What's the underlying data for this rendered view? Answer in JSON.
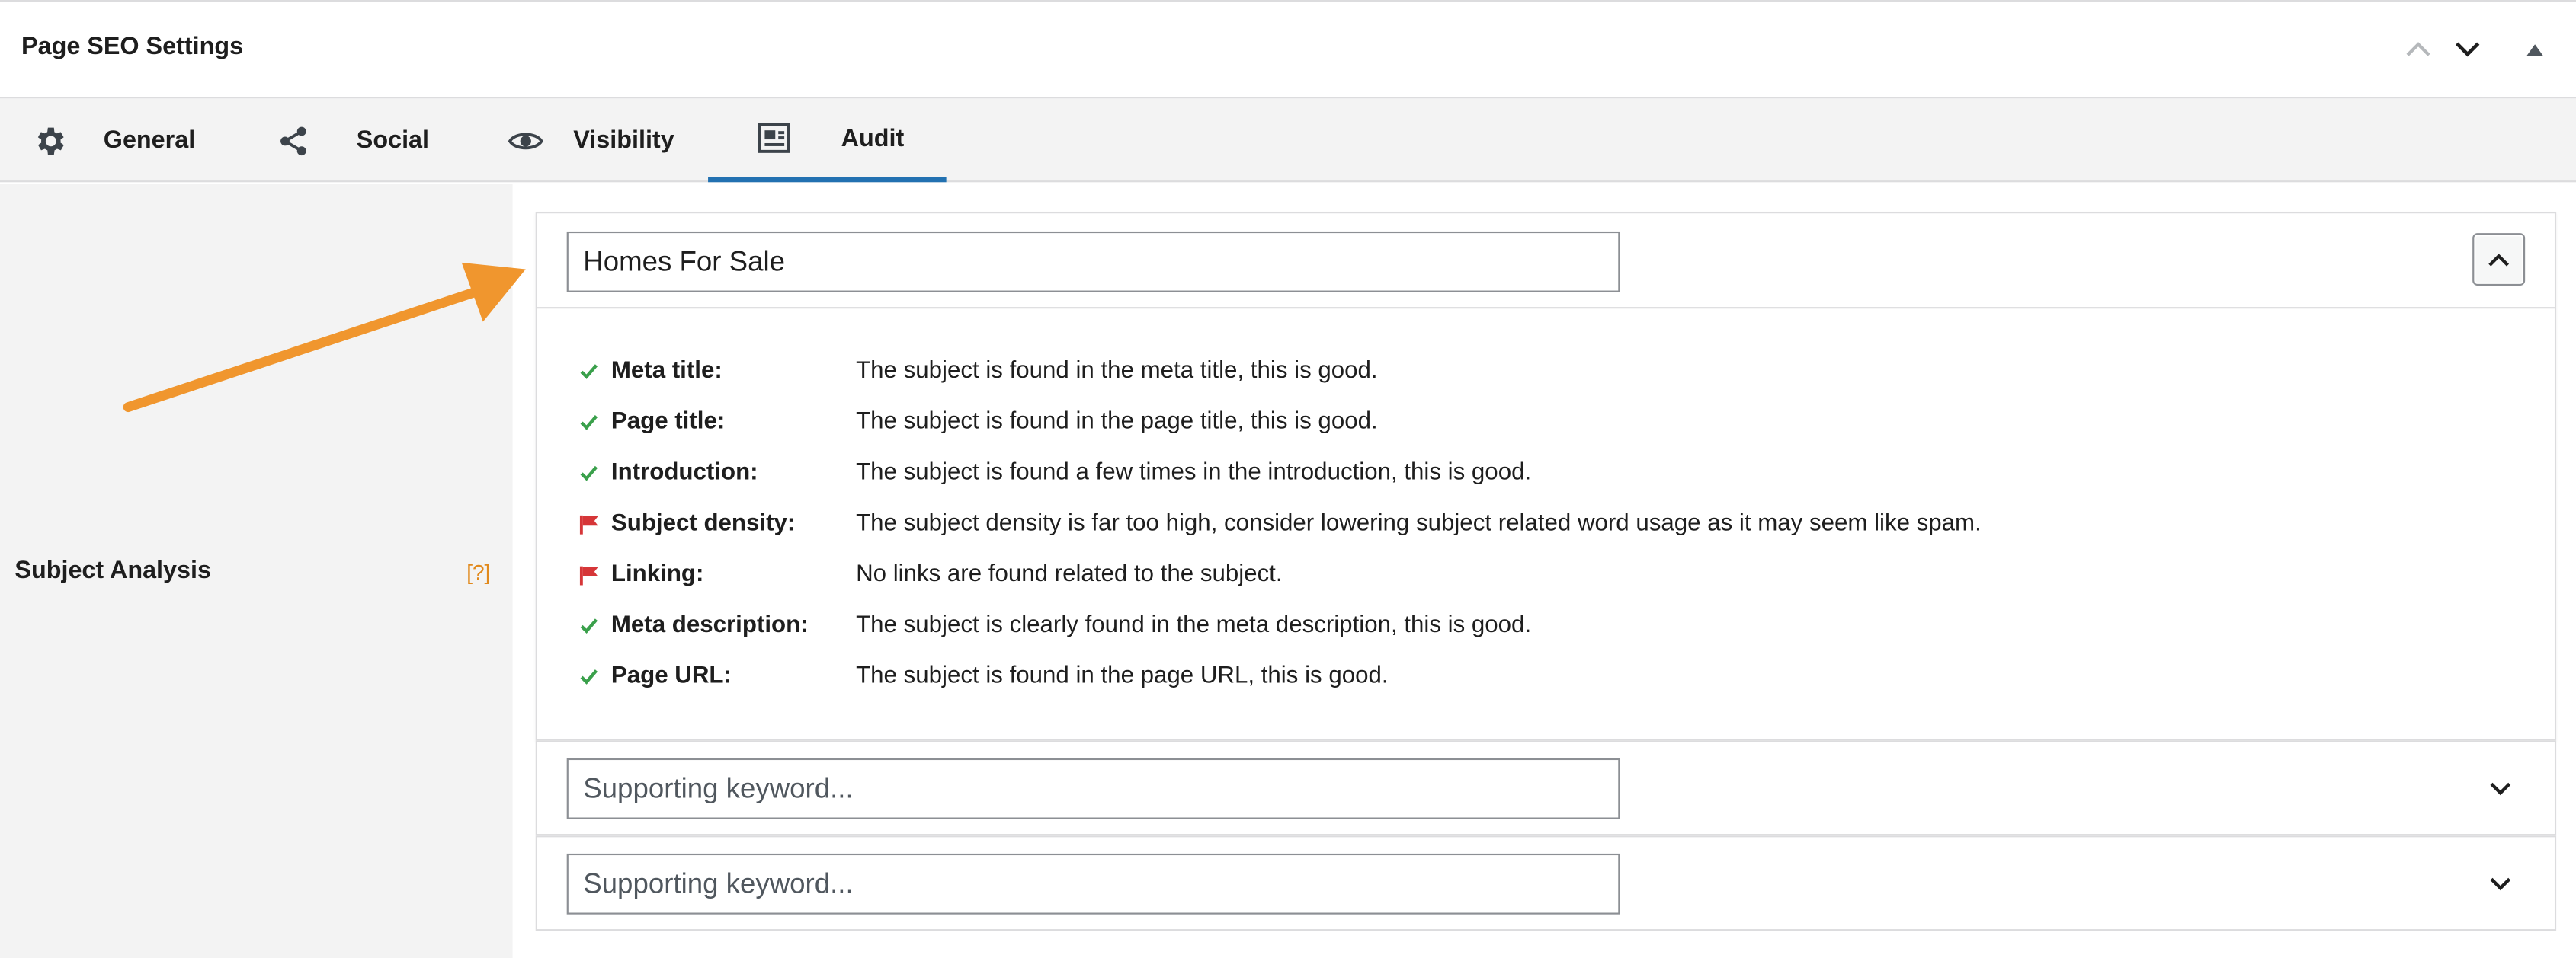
{
  "header": {
    "title": "Page SEO Settings",
    "buttons": [
      "chevron-up-icon",
      "chevron-down-icon",
      "triangle-up-icon"
    ]
  },
  "tabs": [
    {
      "label": "General",
      "icon": "gear-icon",
      "active": false
    },
    {
      "label": "Social",
      "icon": "share-icon",
      "active": false
    },
    {
      "label": "Visibility",
      "icon": "eye-icon",
      "active": false
    },
    {
      "label": "Audit",
      "icon": "audit-icon",
      "active": true
    }
  ],
  "sidebar": {
    "label": "Subject Analysis",
    "help": "[?]"
  },
  "subject": {
    "value": "Homes For Sale",
    "results": [
      {
        "key": "Meta title:",
        "status": "good",
        "text": "The subject is found in the meta title, this is good."
      },
      {
        "key": "Page title:",
        "status": "good",
        "text": "The subject is found in the page title, this is good."
      },
      {
        "key": "Introduction:",
        "status": "good",
        "text": "The subject is found a few times in the introduction, this is good."
      },
      {
        "key": "Subject density:",
        "status": "bad",
        "text": "The subject density is far too high, consider lowering subject related word usage as it may seem like spam."
      },
      {
        "key": "Linking:",
        "status": "bad",
        "text": "No links are found related to the subject."
      },
      {
        "key": "Meta description:",
        "status": "good",
        "text": "The subject is clearly found in the meta description, this is good."
      },
      {
        "key": "Page URL:",
        "status": "good",
        "text": "The subject is found in the page URL, this is good."
      }
    ]
  },
  "supporting": [
    {
      "placeholder": "Supporting keyword...",
      "value": ""
    },
    {
      "placeholder": "Supporting keyword...",
      "value": ""
    }
  ],
  "colors": {
    "good": "#3aa04b",
    "bad": "#d63638",
    "arrow": "#f0962e",
    "tab_active": "#2271b1",
    "help": "#e1891c"
  }
}
